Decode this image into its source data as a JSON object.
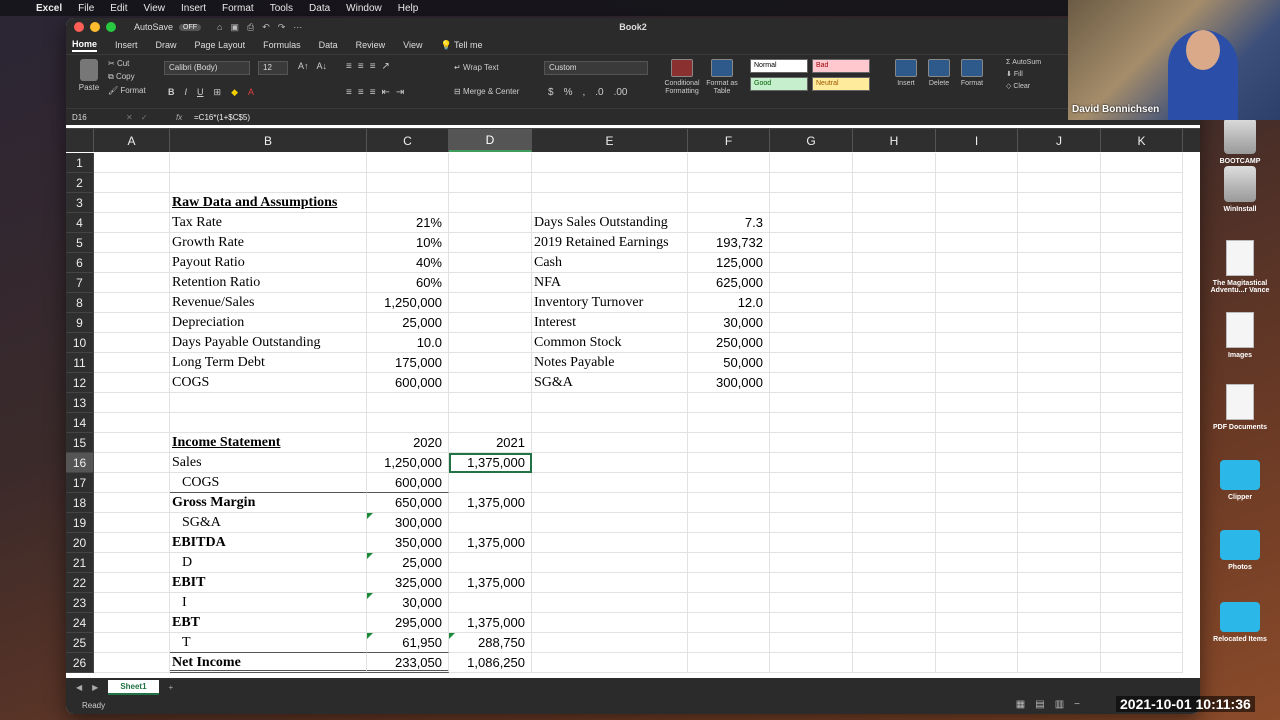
{
  "menubar": {
    "app": "Excel",
    "items": [
      "File",
      "Edit",
      "View",
      "Insert",
      "Format",
      "Tools",
      "Data",
      "Window",
      "Help"
    ]
  },
  "titlebar": {
    "autosave_label": "AutoSave",
    "autosave_state": "OFF",
    "doc_title": "Book2"
  },
  "ribbon_tabs": [
    "Home",
    "Insert",
    "Draw",
    "Page Layout",
    "Formulas",
    "Data",
    "Review",
    "View",
    "Tell me"
  ],
  "ribbon": {
    "paste": "Paste",
    "cut": "Cut",
    "copy": "Copy",
    "format": "Format",
    "font_name": "Calibri (Body)",
    "font_size": "12",
    "wrap_text": "Wrap Text",
    "merge_center": "Merge & Center",
    "number_format": "Custom",
    "conditional_formatting": "Conditional Formatting",
    "format_as_table": "Format as Table",
    "styles": {
      "normal": "Normal",
      "bad": "Bad",
      "good": "Good",
      "neutral": "Neutral"
    },
    "insert": "Insert",
    "delete": "Delete",
    "format_cells": "Format",
    "autosum": "AutoSum",
    "fill": "Fill",
    "clear": "Clear"
  },
  "formula_bar": {
    "name_box": "D16",
    "fx": "fx",
    "formula": "=C16*(1+$C$5)"
  },
  "columns": [
    "A",
    "B",
    "C",
    "D",
    "E",
    "F",
    "G",
    "H",
    "I",
    "J",
    "K"
  ],
  "rows": [
    {
      "n": "1",
      "cells": {}
    },
    {
      "n": "2",
      "cells": {}
    },
    {
      "n": "3",
      "cells": {
        "B": "Raw Data and Assumptions"
      }
    },
    {
      "n": "4",
      "cells": {
        "B": "Tax Rate",
        "C": "21%",
        "E": "Days Sales Outstanding",
        "F": "7.3"
      }
    },
    {
      "n": "5",
      "cells": {
        "B": "Growth Rate",
        "C": "10%",
        "E": "2019 Retained Earnings",
        "F": "193,732"
      }
    },
    {
      "n": "6",
      "cells": {
        "B": "Payout Ratio",
        "C": "40%",
        "E": "Cash",
        "F": "125,000"
      }
    },
    {
      "n": "7",
      "cells": {
        "B": "Retention Ratio",
        "C": "60%",
        "E": "NFA",
        "F": "625,000"
      }
    },
    {
      "n": "8",
      "cells": {
        "B": "Revenue/Sales",
        "C": "1,250,000",
        "E": "Inventory Turnover",
        "F": "12.0"
      }
    },
    {
      "n": "9",
      "cells": {
        "B": "Depreciation",
        "C": "25,000",
        "E": "Interest",
        "F": "30,000"
      }
    },
    {
      "n": "10",
      "cells": {
        "B": "Days Payable Outstanding",
        "C": "10.0",
        "E": "Common Stock",
        "F": "250,000"
      }
    },
    {
      "n": "11",
      "cells": {
        "B": "Long Term Debt",
        "C": "175,000",
        "E": "Notes Payable",
        "F": "50,000"
      }
    },
    {
      "n": "12",
      "cells": {
        "B": "COGS",
        "C": "600,000",
        "E": "SG&A",
        "F": "300,000"
      }
    },
    {
      "n": "13",
      "cells": {}
    },
    {
      "n": "14",
      "cells": {}
    },
    {
      "n": "15",
      "cells": {
        "B": "Income Statement",
        "C": "2020",
        "D": "2021"
      }
    },
    {
      "n": "16",
      "cells": {
        "B": "Sales",
        "C": "1,250,000",
        "D": "1,375,000"
      }
    },
    {
      "n": "17",
      "cells": {
        "B": "COGS",
        "C": "600,000"
      }
    },
    {
      "n": "18",
      "cells": {
        "B": "Gross Margin",
        "C": "650,000",
        "D": "1,375,000"
      }
    },
    {
      "n": "19",
      "cells": {
        "B": "SG&A",
        "C": "300,000"
      }
    },
    {
      "n": "20",
      "cells": {
        "B": "EBITDA",
        "C": "350,000",
        "D": "1,375,000"
      }
    },
    {
      "n": "21",
      "cells": {
        "B": "D",
        "C": "25,000"
      }
    },
    {
      "n": "22",
      "cells": {
        "B": "EBIT",
        "C": "325,000",
        "D": "1,375,000"
      }
    },
    {
      "n": "23",
      "cells": {
        "B": "I",
        "C": "30,000"
      }
    },
    {
      "n": "24",
      "cells": {
        "B": "EBT",
        "C": "295,000",
        "D": "1,375,000"
      }
    },
    {
      "n": "25",
      "cells": {
        "B": "T",
        "C": "61,950",
        "D": "288,750"
      }
    },
    {
      "n": "26",
      "cells": {
        "B": "Net Income",
        "C": "233,050",
        "D": "1,086,250"
      }
    }
  ],
  "selected_cell": {
    "row": "16",
    "col": "D"
  },
  "sheet_tab": "Sheet1",
  "status": "Ready",
  "timestamp": "2021-10-01  10:11:36",
  "webcam_name": "David Bonnichsen",
  "desktop_icons": [
    {
      "label": "BOOTCAMP",
      "kind": "drive"
    },
    {
      "label": "WinInstall",
      "kind": "drive"
    },
    {
      "label": "The Magitastical Adventu...r Vance",
      "kind": "doc"
    },
    {
      "label": "Images",
      "kind": "doc"
    },
    {
      "label": "PDF Documents",
      "kind": "doc"
    },
    {
      "label": "Clipper",
      "kind": "folder"
    },
    {
      "label": "Photos",
      "kind": "folder"
    },
    {
      "label": "Relocated Items",
      "kind": "folder"
    }
  ]
}
